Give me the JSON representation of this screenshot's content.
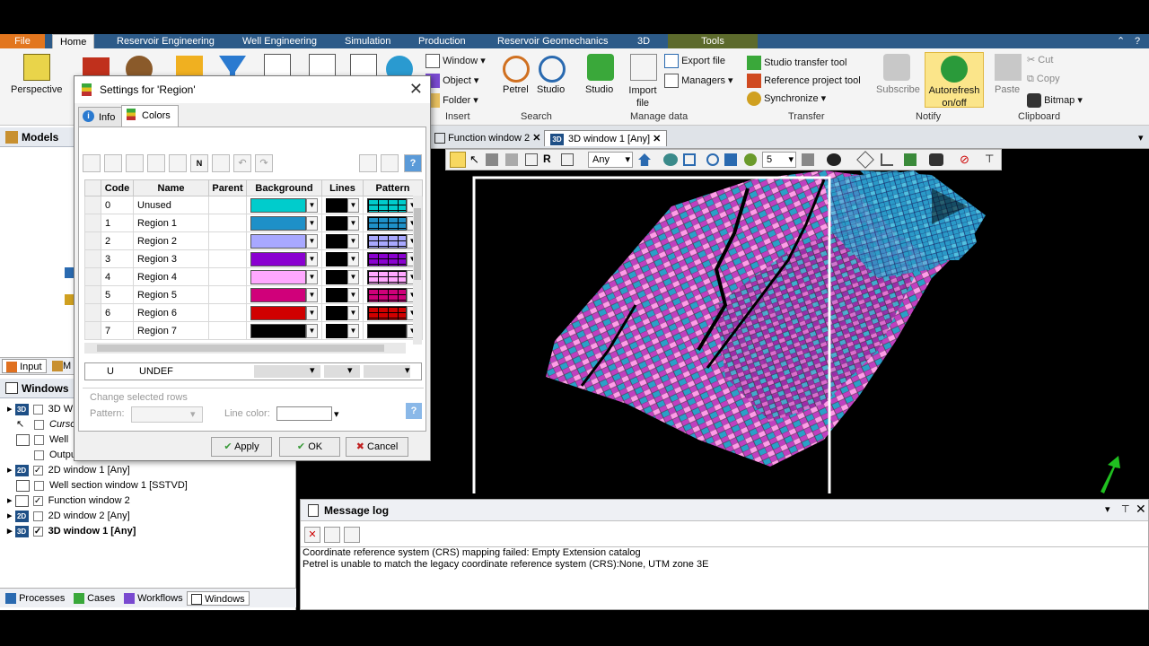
{
  "ribbon": {
    "tabs": [
      "File",
      "Home",
      "Reservoir Engineering",
      "Well Engineering",
      "Simulation",
      "Production",
      "Reservoir Geomechanics",
      "3D",
      "Tools"
    ],
    "perspective": "Perspective",
    "insert": {
      "window": "Window",
      "object": "Object",
      "folder": "Folder",
      "label": "Insert"
    },
    "search": {
      "petrel": "Petrel",
      "studio": "Studio",
      "label": "Search"
    },
    "manage": {
      "studio": "Studio",
      "import": "Import file",
      "export": "Export file",
      "managers": "Managers",
      "label": "Manage data"
    },
    "transfer": {
      "studio_transfer": "Studio transfer tool",
      "reference": "Reference project tool",
      "synchronize": "Synchronize",
      "label": "Transfer"
    },
    "notify": {
      "subscribe": "Subscribe",
      "autorefresh": "Autorefresh on/off",
      "label": "Notify"
    },
    "clipboard": {
      "paste": "Paste",
      "cut": "Cut",
      "copy": "Copy",
      "bitmap": "Bitmap",
      "label": "Clipboard"
    }
  },
  "left": {
    "models_header": "Models",
    "tab_input": "Input",
    "tab_m": "M",
    "windows_header": "Windows",
    "windows": [
      {
        "tag": "3D",
        "label": "3D W",
        "checked": false
      },
      {
        "tag": "",
        "label": "Curso",
        "checked": false
      },
      {
        "tag": "W",
        "label": "Well",
        "checked": false
      },
      {
        "tag": "",
        "label": "Outpu",
        "checked": false
      },
      {
        "tag": "2D",
        "label": "2D window 1 [Any]",
        "checked": true
      },
      {
        "tag": "W",
        "label": "Well section window 1 [SSTVD]",
        "checked": false
      },
      {
        "tag": "F",
        "label": "Function window 2",
        "checked": true
      },
      {
        "tag": "2D",
        "label": "2D window 2 [Any]",
        "checked": false
      },
      {
        "tag": "3D",
        "label": "3D window 1 [Any]",
        "checked": true
      }
    ],
    "bottom_tabs": [
      "Processes",
      "Cases",
      "Workflows",
      "Windows"
    ]
  },
  "viewport": {
    "tabs": [
      "Function window 2",
      "3D window 1 [Any]"
    ],
    "domain_select": "Any",
    "zoom_value": "5"
  },
  "message_log": {
    "title": "Message log",
    "lines": [
      "Coordinate reference system (CRS) mapping failed: Empty Extension catalog",
      "Petrel is unable to match the legacy coordinate reference system (CRS):None, UTM zone 3E"
    ]
  },
  "dialog": {
    "title": "Settings for 'Region'",
    "tabs": [
      "Info",
      "Colors"
    ],
    "columns": [
      "Code",
      "Name",
      "Parent",
      "Background",
      "Lines",
      "Pattern"
    ],
    "rows": [
      {
        "code": "0",
        "name": "Unused",
        "bg": "#00cccc"
      },
      {
        "code": "1",
        "name": "Region 1",
        "bg": "#1e90c8"
      },
      {
        "code": "2",
        "name": "Region 2",
        "bg": "#a8a8ff"
      },
      {
        "code": "3",
        "name": "Region 3",
        "bg": "#8a00d0"
      },
      {
        "code": "4",
        "name": "Region 4",
        "bg": "#ffa8ff"
      },
      {
        "code": "5",
        "name": "Region 5",
        "bg": "#d0007a"
      },
      {
        "code": "6",
        "name": "Region 6",
        "bg": "#d00000"
      },
      {
        "code": "7",
        "name": "Region 7",
        "bg": "#000000"
      }
    ],
    "undef": {
      "code": "U",
      "name": "UNDEF"
    },
    "change_group": "Change selected rows",
    "pattern_label": "Pattern:",
    "line_color_label": "Line color:",
    "apply": "Apply",
    "ok": "OK",
    "cancel": "Cancel"
  }
}
